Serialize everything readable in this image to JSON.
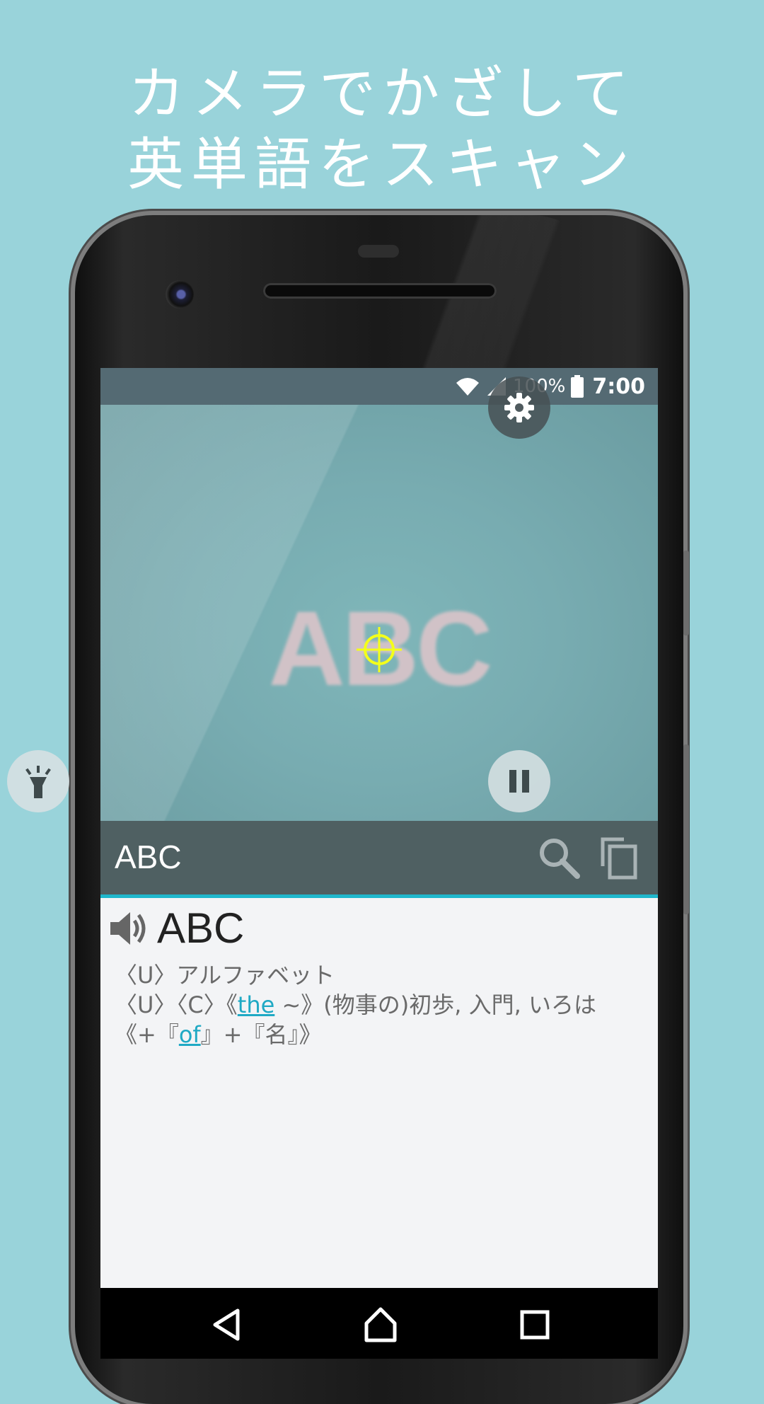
{
  "promo": {
    "line1": "カメラでかざして",
    "line2": "英単語をスキャン"
  },
  "status_bar": {
    "battery_percent": "100%",
    "time": "7:00",
    "icons": [
      "wifi-icon",
      "signal-icon",
      "battery-icon"
    ]
  },
  "camera": {
    "scanned_text": "ABC",
    "crosshair_color": "#f4ff1a",
    "buttons": [
      "settings-icon",
      "flashlight-icon",
      "pause-icon"
    ]
  },
  "result_bar": {
    "word": "ABC",
    "actions": [
      "search-icon",
      "copy-icon"
    ],
    "accent_color": "#1fb7cc"
  },
  "dictionary": {
    "headword": "ABC",
    "line1": "〈U〉アルファベット",
    "line2_a": "〈U〉〈C〉《",
    "line2_link": "the",
    "line2_b": " ~》(物事の)初歩, 入門, いろは",
    "line3_a": "《+『",
    "line3_link": "of",
    "line3_b": "』+『名』》",
    "link_color": "#1fa9c4"
  },
  "nav_bar": [
    "back-icon",
    "home-icon",
    "recents-icon"
  ]
}
